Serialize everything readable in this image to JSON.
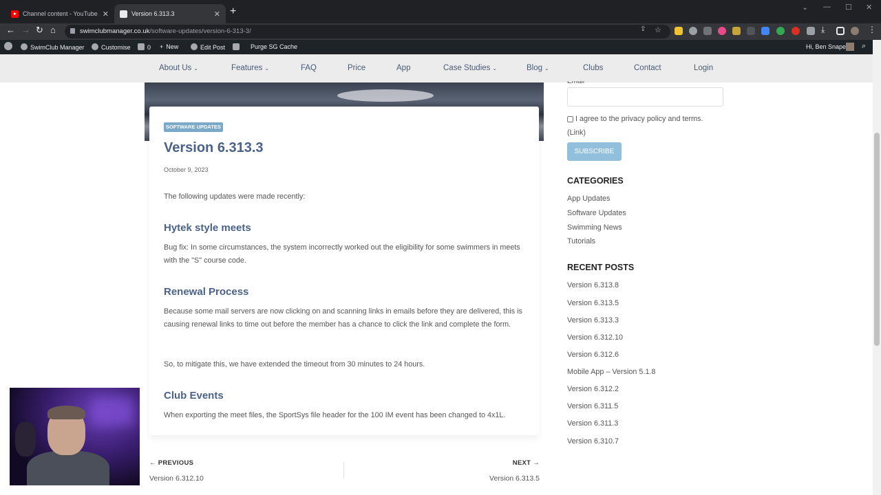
{
  "browser": {
    "tabs": [
      {
        "title": "Channel content - YouTube Studio"
      },
      {
        "title": "Version 6.313.3"
      }
    ],
    "url_domain": "swimclubmanager.co.uk",
    "url_path": "/software-updates/version-6-313-3/"
  },
  "adminbar": {
    "site": "SwimClub Manager",
    "customise": "Customise",
    "comments": "0",
    "new": "New",
    "edit_post": "Edit Post",
    "purge": "Purge SG Cache",
    "greeting": "Hi, Ben Snape"
  },
  "nav": {
    "items": [
      {
        "label": "About Us",
        "caret": "⌄"
      },
      {
        "label": "Features",
        "caret": "⌄"
      },
      {
        "label": "FAQ"
      },
      {
        "label": "Price"
      },
      {
        "label": "App"
      },
      {
        "label": "Case Studies",
        "caret": "⌄"
      },
      {
        "label": "Blog",
        "caret": "⌄"
      },
      {
        "label": "Clubs"
      },
      {
        "label": "Contact"
      },
      {
        "label": "Login"
      }
    ]
  },
  "post": {
    "category": "SOFTWARE UPDATES",
    "title": "Version 6.313.3",
    "date": "October 9, 2023",
    "intro": "The following updates were made recently:",
    "sections": [
      {
        "heading": "Hytek style meets",
        "paragraphs": [
          "Bug fix: In some circumstances, the system incorrectly worked out the eligibility for some swimmers in meets with the \"S\" course code."
        ]
      },
      {
        "heading": "Renewal Process",
        "paragraphs": [
          "Because some mail servers are now clicking on and scanning links in emails before they are delivered, this is causing renewal links to time out before the member has a chance to click the link and complete the form.",
          "So, to mitigate this, we have extended the timeout from 30 minutes to 24 hours."
        ]
      },
      {
        "heading": "Club Events",
        "paragraphs": [
          "When exporting the meet files, the SportSys file header for the 100 IM event has been changed to 4x1L."
        ]
      }
    ]
  },
  "post_nav": {
    "previous_label": "← PREVIOUS",
    "previous_title": "Version 6.312.10",
    "next_label": "NEXT →",
    "next_title": "Version 6.313.5"
  },
  "sidebar": {
    "email_label": "Email",
    "agree": "I agree to the privacy policy and terms.",
    "link": "(Link)",
    "subscribe": "SUBSCRIBE",
    "categories_heading": "CATEGORIES",
    "categories": [
      "App Updates",
      "Software Updates",
      "Swimming News",
      "Tutorials"
    ],
    "recent_heading": "RECENT POSTS",
    "recent": [
      "Version 6.313.8",
      "Version 6.313.5",
      "Version 6.313.3",
      "Version 6.312.10",
      "Version 6.312.6",
      "Mobile App – Version 5.1.8",
      "Version 6.312.2",
      "Version 6.311.5",
      "Version 6.311.3",
      "Version 6.310.7"
    ]
  },
  "colors": {
    "accent": "#4a6287",
    "badge": "#7aa9c9",
    "button": "#92c0dc"
  }
}
